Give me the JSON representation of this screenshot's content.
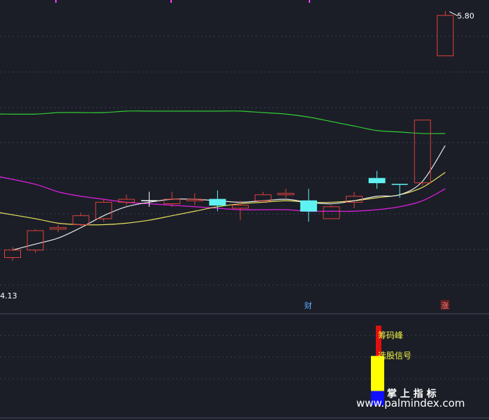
{
  "chart_data": {
    "type": "candlestick",
    "price_ylim": [
      3.9,
      5.85
    ],
    "grid": true,
    "candles": [
      {
        "o": 4.15,
        "c": 4.2,
        "h": 4.22,
        "l": 4.13,
        "up": true
      },
      {
        "o": 4.2,
        "c": 4.33,
        "h": 4.34,
        "l": 4.18,
        "up": true
      },
      {
        "o": 4.34,
        "c": 4.35,
        "h": 4.37,
        "l": 4.32,
        "up": true
      },
      {
        "o": 4.37,
        "c": 4.43,
        "h": 4.45,
        "l": 4.36,
        "up": true
      },
      {
        "o": 4.41,
        "c": 4.52,
        "h": 4.54,
        "l": 4.39,
        "up": true
      },
      {
        "o": 4.52,
        "c": 4.54,
        "h": 4.57,
        "l": 4.5,
        "up": true
      },
      {
        "o": 4.53,
        "c": 4.53,
        "h": 4.59,
        "l": 4.49,
        "up": true,
        "doji": true
      },
      {
        "o": 4.51,
        "c": 4.54,
        "h": 4.59,
        "l": 4.49,
        "up": true
      },
      {
        "o": 4.53,
        "c": 4.54,
        "h": 4.58,
        "l": 4.5,
        "up": true
      },
      {
        "o": 4.54,
        "c": 4.5,
        "h": 4.6,
        "l": 4.46,
        "up": false
      },
      {
        "o": 4.48,
        "c": 4.5,
        "h": 4.53,
        "l": 4.4,
        "up": true
      },
      {
        "o": 4.53,
        "c": 4.57,
        "h": 4.59,
        "l": 4.52,
        "up": true
      },
      {
        "o": 4.57,
        "c": 4.58,
        "h": 4.61,
        "l": 4.55,
        "up": true
      },
      {
        "o": 4.53,
        "c": 4.46,
        "h": 4.61,
        "l": 4.39,
        "up": false
      },
      {
        "o": 4.41,
        "c": 4.49,
        "h": 4.5,
        "l": 4.41,
        "up": true
      },
      {
        "o": 4.52,
        "c": 4.56,
        "h": 4.59,
        "l": 4.48,
        "up": true
      },
      {
        "o": 4.68,
        "c": 4.65,
        "h": 4.73,
        "l": 4.61,
        "up": false
      },
      {
        "o": 4.64,
        "c": 4.64,
        "h": 4.64,
        "l": 4.55,
        "up": false,
        "doji": true
      },
      {
        "o": 4.65,
        "c": 5.07,
        "h": 5.07,
        "l": 4.63,
        "up": true
      },
      {
        "o": 5.5,
        "c": 5.77,
        "h": 5.8,
        "l": 5.5,
        "up": true
      }
    ],
    "ma_white": [
      4.2,
      4.24,
      4.28,
      4.35,
      4.43,
      4.49,
      4.52,
      4.54,
      4.54,
      4.53,
      4.52,
      4.53,
      4.54,
      4.52,
      4.51,
      4.53,
      4.56,
      4.57,
      4.66,
      4.9
    ],
    "ma_yellow": [
      4.45,
      4.41,
      4.38,
      4.37,
      4.37,
      4.38,
      4.4,
      4.43,
      4.46,
      4.49,
      4.51,
      4.52,
      4.53,
      4.52,
      4.52,
      4.53,
      4.55,
      4.57,
      4.62,
      4.72
    ],
    "ma_magenta": [
      4.69,
      4.64,
      4.59,
      4.56,
      4.54,
      4.52,
      4.51,
      4.5,
      4.49,
      4.48,
      4.47,
      4.47,
      4.47,
      4.46,
      4.46,
      4.46,
      4.47,
      4.49,
      4.53,
      4.61
    ],
    "ma_green": [
      5.11,
      5.11,
      5.12,
      5.12,
      5.12,
      5.13,
      5.13,
      5.13,
      5.13,
      5.13,
      5.13,
      5.12,
      5.11,
      5.09,
      5.06,
      5.03,
      5.0,
      4.99,
      4.98,
      4.98
    ],
    "low_label": "4.13",
    "high_label": "5.80",
    "markers": [
      {
        "index": 13,
        "text": "财",
        "color": "#5fa8ff"
      },
      {
        "index": 19,
        "text": "涨",
        "color": "#ff7777"
      }
    ],
    "indicator": {
      "bars": [
        {
          "name": "筹码峰",
          "value": 1.0,
          "color": "#e01010"
        },
        {
          "name": "选股信号",
          "value": 0.62,
          "color": "#ffff00"
        },
        {
          "name": "掌上指标",
          "value": 0.18,
          "color": "#1010ff"
        }
      ],
      "labels": [
        "筹码峰",
        "选股信号"
      ]
    }
  },
  "watermark": {
    "title": "掌 上 指 标",
    "url": "www.palmindex.com"
  },
  "colors": {
    "background": "#1b1e27",
    "up": "#e0403a",
    "down": "#5ff2f2",
    "grid": "#3a3f52",
    "label_yellow": "#f0f040"
  }
}
